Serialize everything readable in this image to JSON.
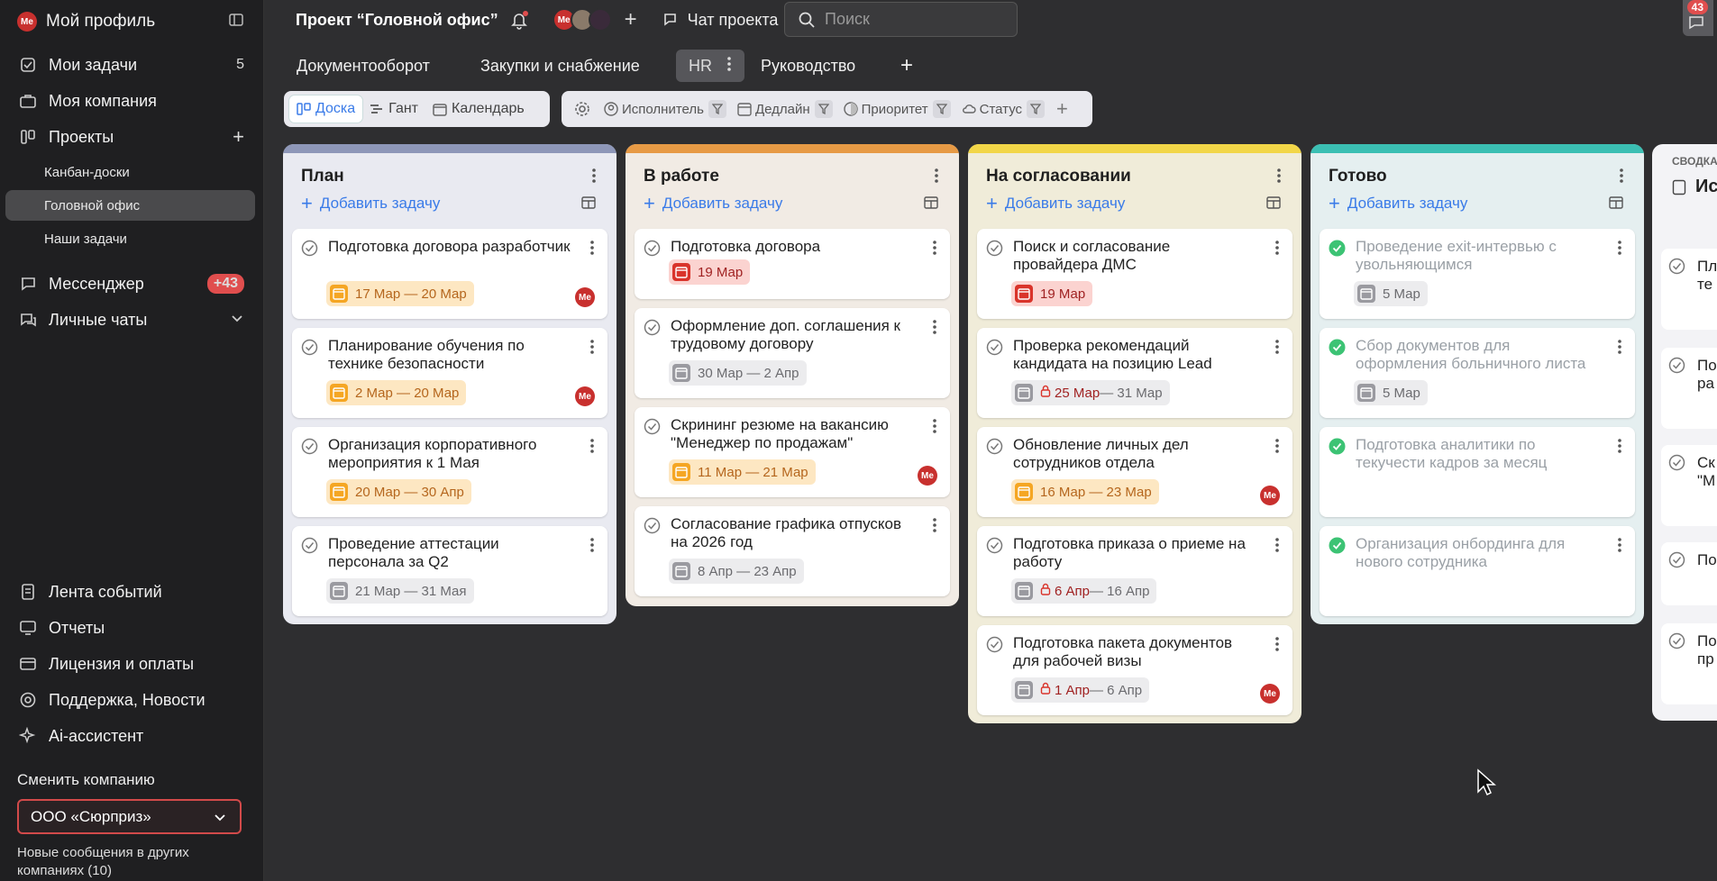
{
  "sidebar": {
    "profile": "Мой профиль",
    "my_tasks": {
      "label": "Мои задачи",
      "count": "5"
    },
    "my_company": "Моя компания",
    "projects": "Проекты",
    "sub_items": [
      "Канбан-доски",
      "Головной офис",
      "Наши задачи"
    ],
    "messenger": {
      "label": "Мессенджер",
      "badge": "+43"
    },
    "personal_chats": "Личные чаты",
    "bottom": [
      "Лента событий",
      "Отчеты",
      "Лицензия и оплаты",
      "Поддержка, Новости",
      "Ai-ассистент"
    ],
    "switch_company": "Сменить компанию",
    "company_value": "ООО «Сюрприз»",
    "new_messages": "Новые сообщения в других компаниях (10)"
  },
  "topbar": {
    "project_title": "Проект “Головной офис”",
    "chat": "Чат проекта",
    "search_placeholder": "Поиск",
    "notif_count": "43"
  },
  "tabs": [
    "Документооборот",
    "Закупки и снабжение",
    "HR",
    "Руководство"
  ],
  "views": [
    "Доска",
    "Гант",
    "Календарь"
  ],
  "filters": [
    "Исполнитель",
    "Дедлайн",
    "Приоритет",
    "Статус"
  ],
  "avatar_initials": "Me",
  "add_task": "Добавить задачу",
  "columns": [
    {
      "title": "План",
      "cards": [
        {
          "title": "Подготовка договора разработчик",
          "date": "17 Мар — 20 Мар"
        },
        {
          "title": "Планирование обучения по технике безопасности",
          "date": "2 Мар — 20 Мар"
        },
        {
          "title": "Организация корпоративного мероприятия к 1 Мая",
          "date": "20 Мар — 30 Апр"
        },
        {
          "title": "Проведение аттестации персонала за Q2",
          "date": "21 Мар — 31 Мая"
        }
      ]
    },
    {
      "title": "В работе",
      "cards": [
        {
          "title": "Подготовка договора",
          "date": "19 Мар"
        },
        {
          "title": "Оформление доп. соглашения к трудовому договору",
          "date": "30 Мар — 2 Апр"
        },
        {
          "title": "Скрининг резюме на вакансию \"Менеджер по продажам\"",
          "date": "11 Мар — 21 Мар"
        },
        {
          "title": "Согласование графика отпусков на 2026 год",
          "date": "8 Апр — 23 Апр"
        }
      ]
    },
    {
      "title": "На согласовании",
      "cards": [
        {
          "title": "Поиск и согласование провайдера ДМС",
          "date": "19 Мар"
        },
        {
          "title": "Проверка рекомендаций кандидата на позицию Lead",
          "date_start": "25 Мар",
          "date_end": " — 31 Мар"
        },
        {
          "title": "Обновление личных дел сотрудников отдела",
          "date": "16 Мар — 23 Мар"
        },
        {
          "title": "Подготовка приказа о приеме на работу",
          "date_start": "6 Апр",
          "date_end": " — 16 Апр"
        },
        {
          "title": "Подготовка пакета документов для рабочей визы",
          "date_start": "1 Апр",
          "date_end": " — 6 Апр"
        }
      ]
    },
    {
      "title": "Готово",
      "cards": [
        {
          "title": "Проведение exit-интервью с увольняющимся",
          "date": "5 Мар"
        },
        {
          "title": "Сбор документов для оформления больничного листа",
          "date": "5 Мар"
        },
        {
          "title": "Подготовка аналитики по текучести кадров за месяц"
        },
        {
          "title": "Организация онбординга для нового сотрудника"
        }
      ]
    }
  ],
  "summary": {
    "label": "СВОДКА",
    "title_fragment": "Ис",
    "fragments": [
      "Пл",
      "те",
      "По",
      "ра",
      "Ск",
      "\"М",
      "По",
      "По",
      "пр"
    ]
  },
  "colors": {
    "plan": "#8e97b8",
    "work": "#e79a45",
    "review": "#f2d648",
    "done": "#3bbfb3",
    "accent": "#3a7be8",
    "danger": "#d9342b"
  }
}
